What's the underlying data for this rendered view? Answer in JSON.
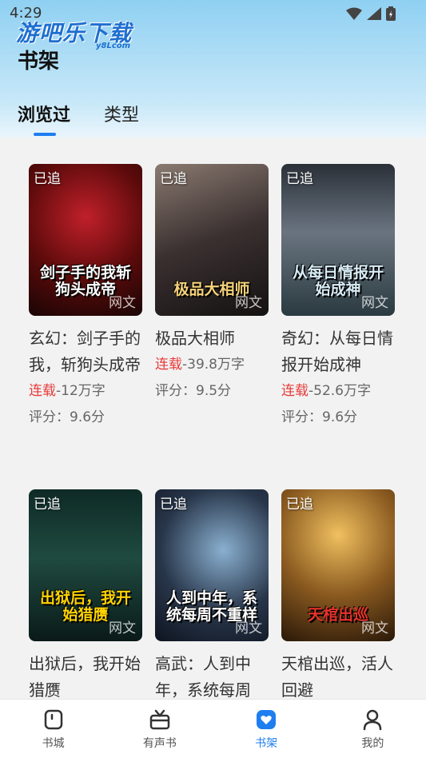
{
  "status_bar": {
    "time": "4:29"
  },
  "logo": {
    "text": "游吧乐下载",
    "sub": "y8Lcom"
  },
  "header": {
    "title": "书架"
  },
  "tabs": [
    {
      "label": "浏览过",
      "active": true
    },
    {
      "label": "类型",
      "active": false
    }
  ],
  "books": [
    {
      "badge": "已追",
      "cover_text": "剑子手的我斩狗头成帝",
      "watermark": "网文",
      "title": "玄幻：剑子手的我，斩狗头成帝",
      "status": "连载",
      "words": "-12万字",
      "rating": "评分：9.6分",
      "cover_color": "#7a1010"
    },
    {
      "badge": "已追",
      "cover_text": "极品大相师",
      "watermark": "网文",
      "title": "极品大相师",
      "status": "连载",
      "words": "-39.8万字",
      "rating": "评分：9.5分",
      "cover_color": "#3a3030"
    },
    {
      "badge": "已追",
      "cover_text": "从每日情报开始成神",
      "watermark": "网文",
      "title": "奇幻：从每日情报开始成神",
      "status": "连载",
      "words": "-52.6万字",
      "rating": "评分：9.6分",
      "cover_color": "#4a5560"
    },
    {
      "badge": "已追",
      "cover_text": "出狱后，我开始猎赝",
      "watermark": "网文",
      "title": "出狱后，我开始猎赝",
      "status": "",
      "words": "",
      "rating": "",
      "cover_color": "#1f4a40"
    },
    {
      "badge": "已追",
      "cover_text": "人到中年，系统每周不重样",
      "watermark": "网文",
      "title": "高武：人到中年，系统每周",
      "status": "",
      "words": "",
      "rating": "",
      "cover_color": "#28364a"
    },
    {
      "badge": "已追",
      "cover_text": "天棺出巡",
      "watermark": "网文",
      "title": "天棺出巡，活人回避",
      "status": "",
      "words": "",
      "rating": "",
      "cover_color": "#6a4a1a"
    }
  ],
  "tabbar": [
    {
      "label": "书城",
      "icon": "bookstore-icon",
      "active": false
    },
    {
      "label": "有声书",
      "icon": "audiobook-icon",
      "active": false
    },
    {
      "label": "书架",
      "icon": "bookshelf-icon",
      "active": true
    },
    {
      "label": "我的",
      "icon": "profile-icon",
      "active": false
    }
  ],
  "colors": {
    "accent": "#1e7ef0",
    "serial": "#e83b3b",
    "header_top": "#8fd0f2"
  }
}
